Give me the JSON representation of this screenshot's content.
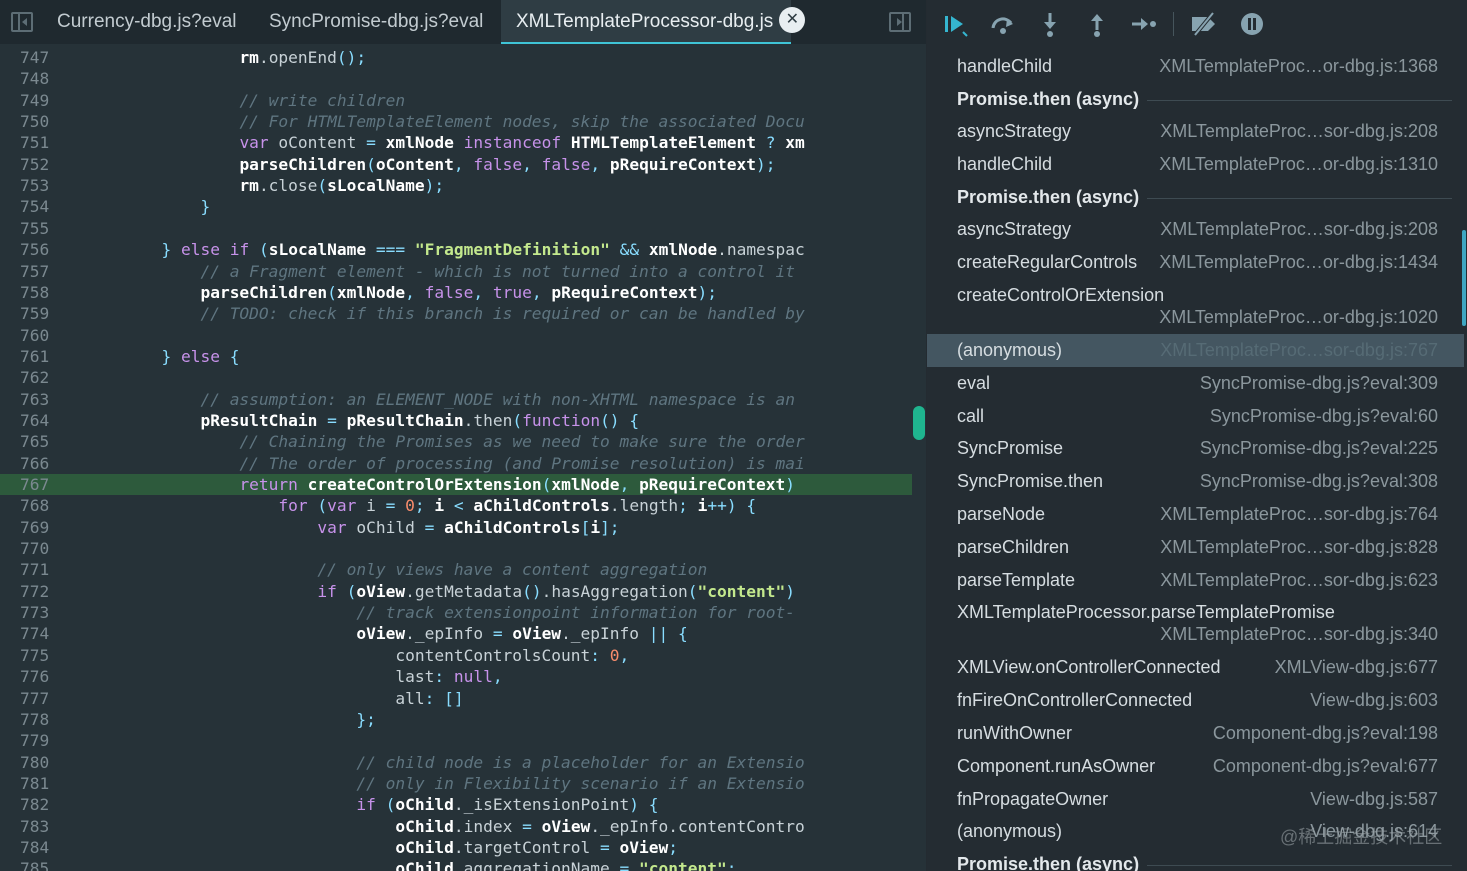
{
  "tabs": [
    {
      "label": "Currency-dbg.js?eval"
    },
    {
      "label": "SyncPromise-dbg.js?eval"
    },
    {
      "label": "XMLTemplateProcessor-dbg.js"
    }
  ],
  "tab_close_glyph": "✕",
  "line_numbers": [
    "747",
    "748",
    "749",
    "750",
    "751",
    "752",
    "753",
    "754",
    "755",
    "756",
    "757",
    "758",
    "759",
    "760",
    "761",
    "762",
    "763",
    "764",
    "765",
    "766",
    "767",
    "768",
    "769",
    "770",
    "771",
    "772",
    "773",
    "774",
    "775",
    "776",
    "777",
    "778",
    "779",
    "780",
    "781",
    "782",
    "783",
    "784",
    "785"
  ],
  "highlight_line": "767",
  "code": [
    [
      [
        "p",
        "                  "
      ],
      [
        "b",
        "rm"
      ],
      [
        "p",
        "."
      ],
      [
        "p",
        "openEnd"
      ],
      [
        "o",
        "();"
      ]
    ],
    [],
    [
      [
        "p",
        "                  "
      ],
      [
        "c",
        "// write children"
      ]
    ],
    [
      [
        "p",
        "                  "
      ],
      [
        "c",
        "// For HTMLTemplateElement nodes, skip the associated Docu"
      ]
    ],
    [
      [
        "p",
        "                  "
      ],
      [
        "k",
        "var"
      ],
      [
        "p",
        " oContent "
      ],
      [
        "o",
        "="
      ],
      [
        "p",
        " "
      ],
      [
        "b",
        "xmlNode"
      ],
      [
        "p",
        " "
      ],
      [
        "k",
        "instanceof"
      ],
      [
        "p",
        " "
      ],
      [
        "b",
        "HTMLTemplateElement"
      ],
      [
        "p",
        " "
      ],
      [
        "o",
        "?"
      ],
      [
        "p",
        " "
      ],
      [
        "b",
        "xm"
      ]
    ],
    [
      [
        "p",
        "                  "
      ],
      [
        "b",
        "parseChildren"
      ],
      [
        "o",
        "("
      ],
      [
        "b",
        "oContent"
      ],
      [
        "o",
        ","
      ],
      [
        "p",
        " "
      ],
      [
        "k",
        "false"
      ],
      [
        "o",
        ","
      ],
      [
        "p",
        " "
      ],
      [
        "k",
        "false"
      ],
      [
        "o",
        ","
      ],
      [
        "p",
        " "
      ],
      [
        "b",
        "pRequireContext"
      ],
      [
        "o",
        ");"
      ]
    ],
    [
      [
        "p",
        "                  "
      ],
      [
        "b",
        "rm"
      ],
      [
        "p",
        ".close"
      ],
      [
        "o",
        "("
      ],
      [
        "b",
        "sLocalName"
      ],
      [
        "o",
        ");"
      ]
    ],
    [
      [
        "p",
        "              "
      ],
      [
        "o",
        "}"
      ]
    ],
    [],
    [
      [
        "p",
        "          "
      ],
      [
        "o",
        "}"
      ],
      [
        "p",
        " "
      ],
      [
        "k",
        "else"
      ],
      [
        "p",
        " "
      ],
      [
        "k",
        "if"
      ],
      [
        "p",
        " "
      ],
      [
        "o",
        "("
      ],
      [
        "b",
        "sLocalName"
      ],
      [
        "p",
        " "
      ],
      [
        "o",
        "==="
      ],
      [
        "p",
        " "
      ],
      [
        "s",
        "\"FragmentDefinition\""
      ],
      [
        "p",
        " "
      ],
      [
        "o",
        "&&"
      ],
      [
        "p",
        " "
      ],
      [
        "b",
        "xmlNode"
      ],
      [
        "p",
        ".namespac"
      ]
    ],
    [
      [
        "p",
        "              "
      ],
      [
        "c",
        "// a Fragment element - which is not turned into a control it"
      ]
    ],
    [
      [
        "p",
        "              "
      ],
      [
        "b",
        "parseChildren"
      ],
      [
        "o",
        "("
      ],
      [
        "b",
        "xmlNode"
      ],
      [
        "o",
        ","
      ],
      [
        "p",
        " "
      ],
      [
        "k",
        "false"
      ],
      [
        "o",
        ","
      ],
      [
        "p",
        " "
      ],
      [
        "k",
        "true"
      ],
      [
        "o",
        ","
      ],
      [
        "p",
        " "
      ],
      [
        "b",
        "pRequireContext"
      ],
      [
        "o",
        ");"
      ]
    ],
    [
      [
        "p",
        "              "
      ],
      [
        "c",
        "// TODO: check if this branch is required or can be handled by"
      ]
    ],
    [],
    [
      [
        "p",
        "          "
      ],
      [
        "o",
        "}"
      ],
      [
        "p",
        " "
      ],
      [
        "k",
        "else"
      ],
      [
        "p",
        " "
      ],
      [
        "o",
        "{"
      ]
    ],
    [],
    [
      [
        "p",
        "              "
      ],
      [
        "c",
        "// assumption: an ELEMENT_NODE with non-XHTML namespace is an"
      ]
    ],
    [
      [
        "p",
        "              "
      ],
      [
        "b",
        "pResultChain"
      ],
      [
        "p",
        " "
      ],
      [
        "o",
        "="
      ],
      [
        "p",
        " "
      ],
      [
        "b",
        "pResultChain"
      ],
      [
        "p",
        ".then"
      ],
      [
        "o",
        "("
      ],
      [
        "k",
        "function"
      ],
      [
        "o",
        "()"
      ],
      [
        "p",
        " "
      ],
      [
        "o",
        "{"
      ]
    ],
    [
      [
        "p",
        "                  "
      ],
      [
        "c",
        "// Chaining the Promises as we need to make sure the order"
      ]
    ],
    [
      [
        "p",
        "                  "
      ],
      [
        "c",
        "// The order of processing (and Promise resolution) is mai"
      ]
    ],
    [
      [
        "p",
        "                  "
      ],
      [
        "k",
        "return"
      ],
      [
        "p",
        " "
      ],
      [
        "b",
        "createControlOrExtension"
      ],
      [
        "o",
        "("
      ],
      [
        "b",
        "xmlNode"
      ],
      [
        "o",
        ","
      ],
      [
        "p",
        " "
      ],
      [
        "b",
        "pRequireContext"
      ],
      [
        "o",
        ")"
      ]
    ],
    [
      [
        "p",
        "                      "
      ],
      [
        "k",
        "for"
      ],
      [
        "p",
        " "
      ],
      [
        "o",
        "("
      ],
      [
        "k",
        "var"
      ],
      [
        "p",
        " i "
      ],
      [
        "o",
        "="
      ],
      [
        "p",
        " "
      ],
      [
        "n",
        "0"
      ],
      [
        "o",
        ";"
      ],
      [
        "p",
        " "
      ],
      [
        "b",
        "i"
      ],
      [
        "p",
        " "
      ],
      [
        "o",
        "<"
      ],
      [
        "p",
        " "
      ],
      [
        "b",
        "aChildControls"
      ],
      [
        "p",
        ".length"
      ],
      [
        "o",
        ";"
      ],
      [
        "p",
        " "
      ],
      [
        "b",
        "i"
      ],
      [
        "o",
        "++)"
      ],
      [
        "p",
        " "
      ],
      [
        "o",
        "{"
      ]
    ],
    [
      [
        "p",
        "                          "
      ],
      [
        "k",
        "var"
      ],
      [
        "p",
        " oChild "
      ],
      [
        "o",
        "="
      ],
      [
        "p",
        " "
      ],
      [
        "b",
        "aChildControls"
      ],
      [
        "o",
        "["
      ],
      [
        "b",
        "i"
      ],
      [
        "o",
        "];"
      ]
    ],
    [],
    [
      [
        "p",
        "                          "
      ],
      [
        "c",
        "// only views have a content aggregation"
      ]
    ],
    [
      [
        "p",
        "                          "
      ],
      [
        "k",
        "if"
      ],
      [
        "p",
        " "
      ],
      [
        "o",
        "("
      ],
      [
        "b",
        "oView"
      ],
      [
        "p",
        ".getMetadata"
      ],
      [
        "o",
        "()"
      ],
      [
        "p",
        ".hasAggregation"
      ],
      [
        "o",
        "("
      ],
      [
        "s",
        "\"content\""
      ],
      [
        "o",
        ")"
      ]
    ],
    [
      [
        "p",
        "                              "
      ],
      [
        "c",
        "// track extensionpoint information for root-"
      ]
    ],
    [
      [
        "p",
        "                              "
      ],
      [
        "b",
        "oView"
      ],
      [
        "p",
        "._epInfo "
      ],
      [
        "o",
        "="
      ],
      [
        "p",
        " "
      ],
      [
        "b",
        "oView"
      ],
      [
        "p",
        "._epInfo "
      ],
      [
        "o",
        "||"
      ],
      [
        "p",
        " "
      ],
      [
        "o",
        "{"
      ]
    ],
    [
      [
        "p",
        "                                  contentControlsCount"
      ],
      [
        "o",
        ":"
      ],
      [
        "p",
        " "
      ],
      [
        "n",
        "0"
      ],
      [
        "o",
        ","
      ]
    ],
    [
      [
        "p",
        "                                  last"
      ],
      [
        "o",
        ":"
      ],
      [
        "p",
        " "
      ],
      [
        "k",
        "null"
      ],
      [
        "o",
        ","
      ]
    ],
    [
      [
        "p",
        "                                  all"
      ],
      [
        "o",
        ":"
      ],
      [
        "p",
        " "
      ],
      [
        "o",
        "[]"
      ]
    ],
    [
      [
        "p",
        "                              "
      ],
      [
        "o",
        "};"
      ]
    ],
    [],
    [
      [
        "p",
        "                              "
      ],
      [
        "c",
        "// child node is a placeholder for an Extensio"
      ]
    ],
    [
      [
        "p",
        "                              "
      ],
      [
        "c",
        "// only in Flexibility scenario if an Extensio"
      ]
    ],
    [
      [
        "p",
        "                              "
      ],
      [
        "k",
        "if"
      ],
      [
        "p",
        " "
      ],
      [
        "o",
        "("
      ],
      [
        "b",
        "oChild"
      ],
      [
        "p",
        "._isExtensionPoint"
      ],
      [
        "o",
        ")"
      ],
      [
        "p",
        " "
      ],
      [
        "o",
        "{"
      ]
    ],
    [
      [
        "p",
        "                                  "
      ],
      [
        "b",
        "oChild"
      ],
      [
        "p",
        ".index "
      ],
      [
        "o",
        "="
      ],
      [
        "p",
        " "
      ],
      [
        "b",
        "oView"
      ],
      [
        "p",
        "._epInfo.contentContro"
      ]
    ],
    [
      [
        "p",
        "                                  "
      ],
      [
        "b",
        "oChild"
      ],
      [
        "p",
        ".targetControl "
      ],
      [
        "o",
        "="
      ],
      [
        "p",
        " "
      ],
      [
        "b",
        "oView"
      ],
      [
        "o",
        ";"
      ]
    ],
    [
      [
        "p",
        "                                  "
      ],
      [
        "b",
        "oChild"
      ],
      [
        "p",
        ".aggregationName "
      ],
      [
        "o",
        "="
      ],
      [
        "p",
        " "
      ],
      [
        "s",
        "\"content\""
      ],
      [
        "o",
        ";"
      ]
    ]
  ],
  "debug_toolbar": [
    "resume-icon",
    "step-over-icon",
    "step-into-icon",
    "step-out-icon",
    "step-icon",
    "deactivate-breakpoints-icon",
    "pause-on-exceptions-icon"
  ],
  "call_stack": [
    {
      "kind": "frame",
      "name": "handleChild",
      "location": "XMLTemplateProc…or-dbg.js:1368"
    },
    {
      "kind": "async",
      "label": "Promise.then (async)"
    },
    {
      "kind": "frame",
      "name": "asyncStrategy",
      "location": "XMLTemplateProc…sor-dbg.js:208"
    },
    {
      "kind": "frame",
      "name": "handleChild",
      "location": "XMLTemplateProc…or-dbg.js:1310"
    },
    {
      "kind": "async",
      "label": "Promise.then (async)"
    },
    {
      "kind": "frame",
      "name": "asyncStrategy",
      "location": "XMLTemplateProc…sor-dbg.js:208"
    },
    {
      "kind": "frame",
      "name": "createRegularControls",
      "location": "XMLTemplateProc…or-dbg.js:1434"
    },
    {
      "kind": "frame2",
      "name": "createControlOrExtension",
      "location": "XMLTemplateProc…or-dbg.js:1020"
    },
    {
      "kind": "frame",
      "name": "(anonymous)",
      "location": "XMLTemplateProc…sor-dbg.js:767",
      "selected": true
    },
    {
      "kind": "frame",
      "name": "eval",
      "location": "SyncPromise-dbg.js?eval:309"
    },
    {
      "kind": "frame",
      "name": "call",
      "location": "SyncPromise-dbg.js?eval:60"
    },
    {
      "kind": "frame",
      "name": "SyncPromise",
      "location": "SyncPromise-dbg.js?eval:225"
    },
    {
      "kind": "frame",
      "name": "SyncPromise.then",
      "location": "SyncPromise-dbg.js?eval:308"
    },
    {
      "kind": "frame",
      "name": "parseNode",
      "location": "XMLTemplateProc…sor-dbg.js:764"
    },
    {
      "kind": "frame",
      "name": "parseChildren",
      "location": "XMLTemplateProc…sor-dbg.js:828"
    },
    {
      "kind": "frame",
      "name": "parseTemplate",
      "location": "XMLTemplateProc…sor-dbg.js:623"
    },
    {
      "kind": "frame2",
      "name": "XMLTemplateProcessor.parseTemplatePromise",
      "location": "XMLTemplateProc…sor-dbg.js:340"
    },
    {
      "kind": "frame",
      "name": "XMLView.onControllerConnected",
      "location": "XMLView-dbg.js:677"
    },
    {
      "kind": "frame",
      "name": "fnFireOnControllerConnected",
      "location": "View-dbg.js:603"
    },
    {
      "kind": "frame",
      "name": "runWithOwner",
      "location": "Component-dbg.js?eval:198"
    },
    {
      "kind": "frame",
      "name": "Component.runAsOwner",
      "location": "Component-dbg.js?eval:677"
    },
    {
      "kind": "frame",
      "name": "fnPropagateOwner",
      "location": "View-dbg.js:587"
    },
    {
      "kind": "frame",
      "name": "(anonymous)",
      "location": "View-dbg.js:614"
    },
    {
      "kind": "async",
      "label": "Promise.then (async)"
    }
  ],
  "watermark": "@稀土掘金技术社区"
}
